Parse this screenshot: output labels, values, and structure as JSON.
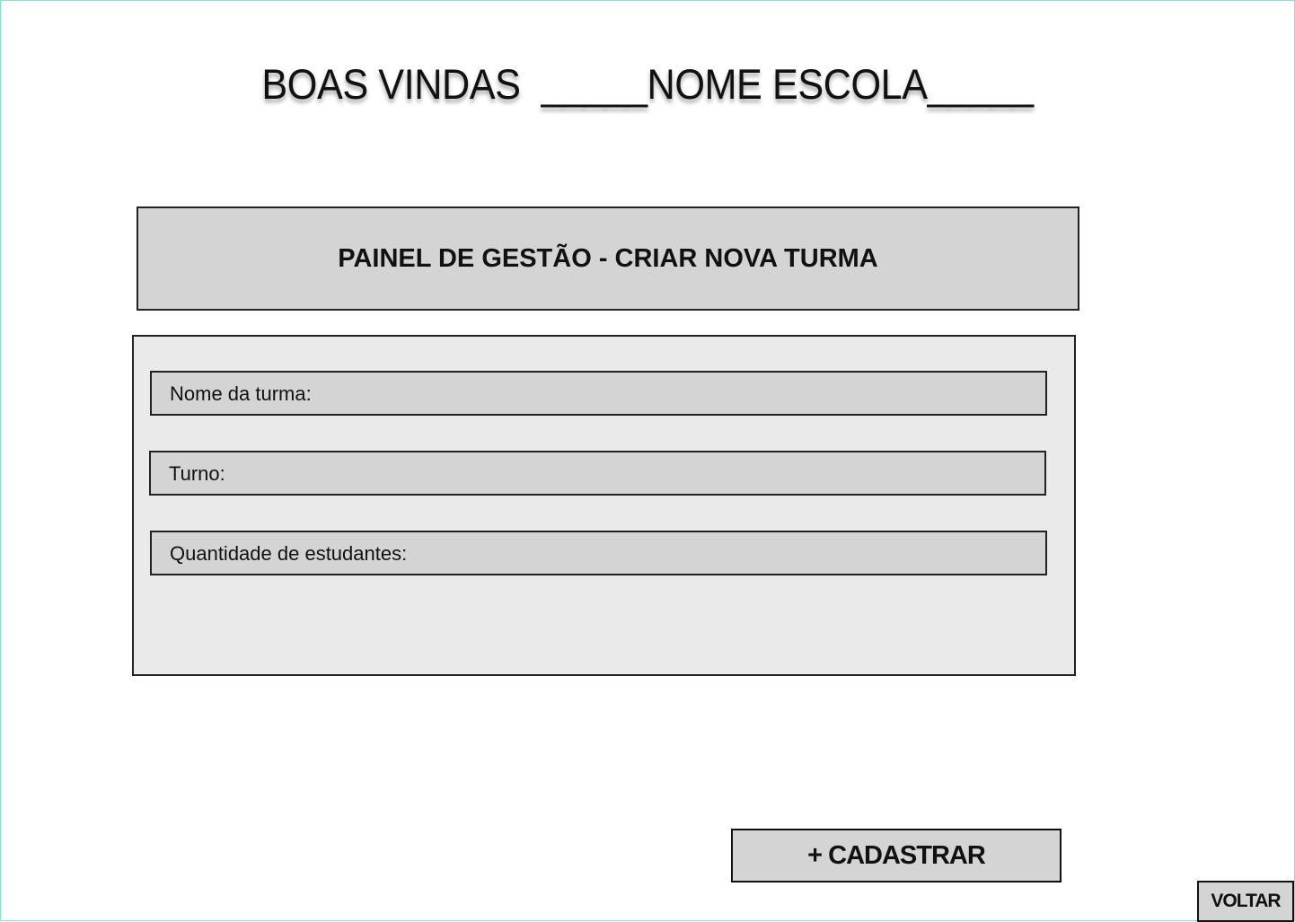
{
  "page": {
    "title": "BOAS VINDAS  _____NOME ESCOLA_____"
  },
  "header": {
    "title": "PAINEL DE GESTÃO - CRIAR NOVA TURMA"
  },
  "form": {
    "fields": [
      {
        "label": "Nome da turma:"
      },
      {
        "label": "Turno:"
      },
      {
        "label": "Quantidade de estudantes:"
      }
    ]
  },
  "actions": {
    "register_label": "+ CADASTRAR",
    "back_label": "VOLTAR"
  },
  "colors": {
    "panel": "#d4d4d4",
    "panel_bg": "#eaeaea",
    "border": "#222222"
  }
}
